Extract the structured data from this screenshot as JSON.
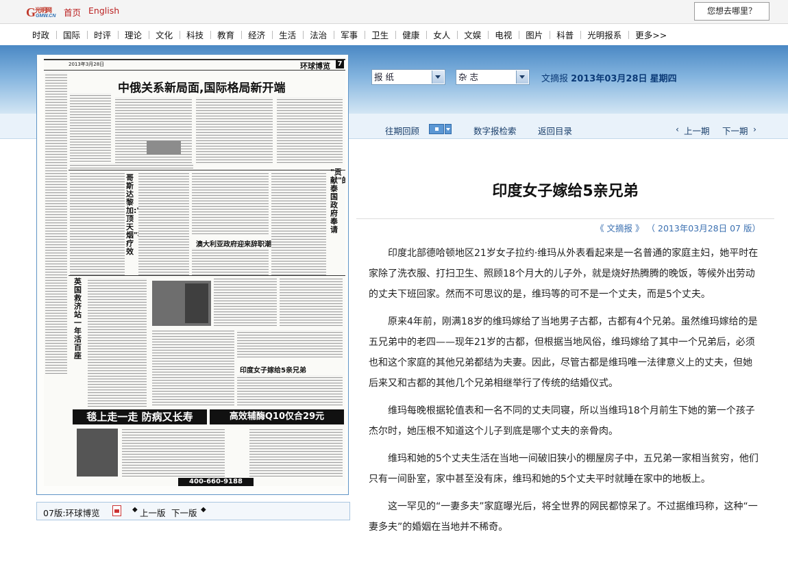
{
  "header": {
    "logo_text": "光明网",
    "logo_sub": "GMW.CN",
    "home": "首页",
    "english": "English",
    "search_placeholder": "您想去哪里？"
  },
  "nav": [
    "时政",
    "国际",
    "时评",
    "理论",
    "文化",
    "科技",
    "教育",
    "经济",
    "生活",
    "法治",
    "军事",
    "卫生",
    "健康",
    "女人",
    "文娱",
    "电视",
    "图片",
    "科普",
    "光明报系",
    "更多>>"
  ],
  "selectors": {
    "newspaper": "报 纸",
    "magazine": "杂 志"
  },
  "paper_info": {
    "name": "文摘报",
    "date": "2013年03月28日",
    "weekday": "星期四"
  },
  "subnav": {
    "past_issues": "往期回顾",
    "search": "数字报检索",
    "back": "返回目录",
    "prev_issue": "上一期",
    "next_issue": "下一期"
  },
  "page_bar": {
    "page": "07版:环球博览",
    "prev": "上一版",
    "next": "下一版"
  },
  "newspaper_image": {
    "masthead": "环球博览",
    "page_num": "7",
    "date": "2013年3月28日",
    "headline": "中俄关系新局面,国际格局新开端",
    "h_left": "哥斯达黎加:\"见顶天烟\"有疗效",
    "h_mid": "澳大利亚政府迎来辞职潮",
    "h_right": "\"贡献\"的泰国政府奉请",
    "h_side": "英国救济站一年活百座",
    "h_story": "印度女子嫁给5亲兄弟",
    "ad1": "毯上走一走 防病又长寿",
    "ad2": "高效辅酶Q10仅合29元",
    "ad_phone": "400-660-9188"
  },
  "article": {
    "title": "印度女子嫁给5亲兄弟",
    "meta_source": "《 文摘报 》",
    "meta_date": "（ 2013年03月28日",
    "meta_page": "07 版）",
    "paragraphs": [
      "印度北部德哈顿地区21岁女子拉约·维玛从外表看起来是一名普通的家庭主妇，她平时在家除了洗衣服、打扫卫生、照顾18个月大的儿子外，就是烧好热腾腾的晚饭，等候外出劳动的丈夫下班回家。然而不可思议的是，维玛等的可不是一个丈夫，而是5个丈夫。",
      "原来4年前，刚满18岁的维玛嫁给了当地男子古都，古都有4个兄弟。虽然维玛嫁给的是五兄弟中的老四——现年21岁的古都，但根据当地风俗，维玛嫁给了其中一个兄弟后，必须也和这个家庭的其他兄弟都结为夫妻。因此，尽管古都是维玛唯一法律意义上的丈夫，但她后来又和古都的其他几个兄弟相继举行了传统的结婚仪式。",
      "维玛每晚根据轮值表和一名不同的丈夫同寝，所以当维玛18个月前生下她的第一个孩子杰尔时，她压根不知道这个儿子到底是哪个丈夫的亲骨肉。",
      "维玛和她的5个丈夫生活在当地一间破旧狭小的棚屋房子中，五兄弟一家相当贫穷，他们只有一间卧室，家中甚至没有床，维玛和她的5个丈夫平时就睡在家中的地板上。",
      "这一罕见的“一妻多夫”家庭曝光后，将全世界的网民都惊呆了。不过据维玛称，这种“一妻多夫”的婚姻在当地并不稀奇。"
    ]
  }
}
